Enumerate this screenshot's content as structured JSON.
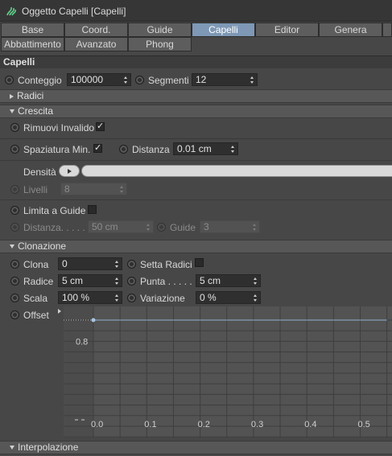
{
  "window": {
    "title": "Oggetto Capelli [Capelli]",
    "icon": "hair-object-icon"
  },
  "tabs_row1": [
    {
      "label": "Base",
      "active": false
    },
    {
      "label": "Coord.",
      "active": false
    },
    {
      "label": "Guide",
      "active": false
    },
    {
      "label": "Capelli",
      "active": true
    },
    {
      "label": "Editor",
      "active": false
    },
    {
      "label": "Genera",
      "active": false
    }
  ],
  "tabs_row2": [
    {
      "label": "Abbattimento"
    },
    {
      "label": "Avanzato"
    },
    {
      "label": "Phong"
    }
  ],
  "section_title": "Capelli",
  "conteggio": {
    "label": "Conteggio",
    "value": "100000"
  },
  "segmenti": {
    "label": "Segmenti",
    "value": "12"
  },
  "radici_group": "Radici",
  "crescita_group": "Crescita",
  "rimuovi": {
    "label": "Rimuovi Invalido",
    "checked": true,
    "mark": "✓"
  },
  "spaziatura": {
    "label": "Spaziatura Min.",
    "checked": true,
    "mark": "✓"
  },
  "distanza": {
    "label": "Distanza",
    "value": "0.01 cm"
  },
  "densita": {
    "label": "Densità"
  },
  "livelli": {
    "label": "Livelli",
    "value": "8"
  },
  "limita": {
    "label": "Limita a Guide",
    "checked": false
  },
  "distanza2": {
    "label": "Distanza. . . . .",
    "value": "50 cm"
  },
  "guide": {
    "label": "Guide",
    "value": "3"
  },
  "clonazione_group": "Clonazione",
  "clona": {
    "label": "Clona",
    "value": "0"
  },
  "setta_radici": {
    "label": "Setta Radici",
    "checked": false
  },
  "radice": {
    "label": "Radice",
    "value": "5 cm"
  },
  "punta": {
    "label": "Punta . . . . .",
    "value": "5 cm"
  },
  "scala": {
    "label": "Scala",
    "value": "100 %"
  },
  "variazione": {
    "label": "Variazione",
    "value": "0 %"
  },
  "offset": {
    "label": "Offset"
  },
  "interpolazione_group": "Interpolazione",
  "chart_data": {
    "type": "line",
    "x_ticks": [
      "0.0",
      "0.1",
      "0.2",
      "0.3",
      "0.4",
      "0.5"
    ],
    "y_ticks": [
      "0.8"
    ],
    "series": [
      {
        "x": [
          0.0,
          0.55
        ],
        "values": [
          1.0,
          1.0
        ]
      }
    ],
    "grid": true,
    "colors": {
      "curve": "#8fb0d0",
      "grid": "#3e3e3e",
      "plot_bg": "#4a4a4a"
    }
  },
  "colors": {
    "active_tab": "#7e98b5",
    "panel_bg": "#474747"
  }
}
